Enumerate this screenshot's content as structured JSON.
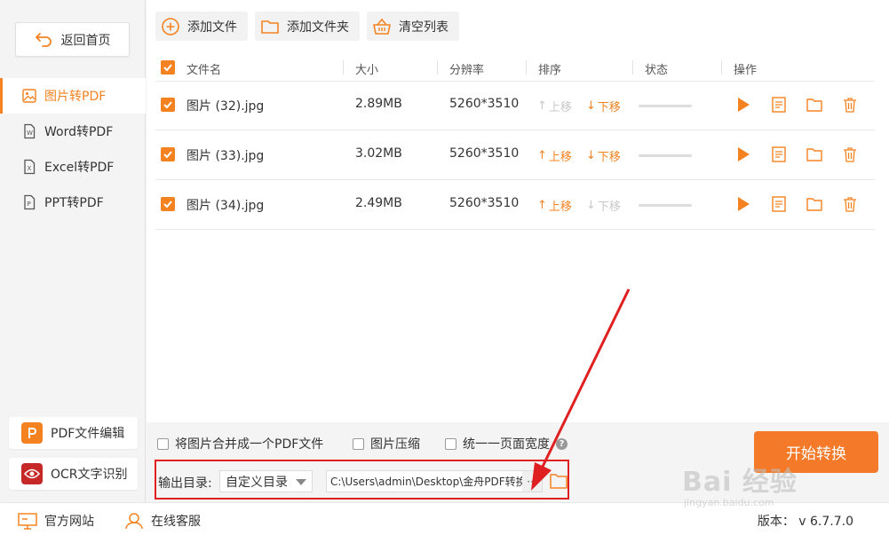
{
  "sidebar": {
    "home_label": "返回首页",
    "items": [
      {
        "label": "图片转PDF",
        "icon": "image-icon",
        "active": true
      },
      {
        "label": "Word转PDF",
        "icon": "word-doc-icon",
        "active": false
      },
      {
        "label": "Excel转PDF",
        "icon": "excel-doc-icon",
        "active": false
      },
      {
        "label": "PPT转PDF",
        "icon": "ppt-doc-icon",
        "active": false
      }
    ],
    "tools": [
      {
        "label": "PDF文件编辑",
        "icon": "pdf-edit-icon",
        "color": "#f58220"
      },
      {
        "label": "OCR文字识别",
        "icon": "ocr-eye-icon",
        "color": "#c62828"
      }
    ]
  },
  "toolbar": {
    "add_file": "添加文件",
    "add_folder": "添加文件夹",
    "clear_list": "清空列表"
  },
  "table": {
    "headers": {
      "name": "文件名",
      "size": "大小",
      "resolution": "分辨率",
      "sort": "排序",
      "status": "状态",
      "actions": "操作"
    },
    "move_up": "上移",
    "move_down": "下移",
    "rows": [
      {
        "name": "图片 (32).jpg",
        "size": "2.89MB",
        "resolution": "5260*3510",
        "up_enabled": false,
        "down_enabled": true,
        "checked": true
      },
      {
        "name": "图片 (33).jpg",
        "size": "3.02MB",
        "resolution": "5260*3510",
        "up_enabled": true,
        "down_enabled": true,
        "checked": true
      },
      {
        "name": "图片 (34).jpg",
        "size": "2.49MB",
        "resolution": "5260*3510",
        "up_enabled": true,
        "down_enabled": false,
        "checked": true
      }
    ]
  },
  "options": {
    "merge": "将图片合并成一个PDF文件",
    "compress": "图片压缩",
    "uniform_width": "统一一页面宽度"
  },
  "output": {
    "label": "输出目录:",
    "mode": "自定义目录",
    "path": "C:\\Users\\admin\\Desktop\\金舟PDF转换",
    "browse": "···"
  },
  "start_label": "开始转换",
  "footer": {
    "website": "官方网站",
    "support": "在线客服",
    "version": "版本： v 6.7.7.0"
  },
  "watermark": {
    "main": "Bai 经验",
    "sub": "jingyan.baidu.com"
  },
  "colors": {
    "accent": "#f58220",
    "annotation": "#e02020"
  }
}
